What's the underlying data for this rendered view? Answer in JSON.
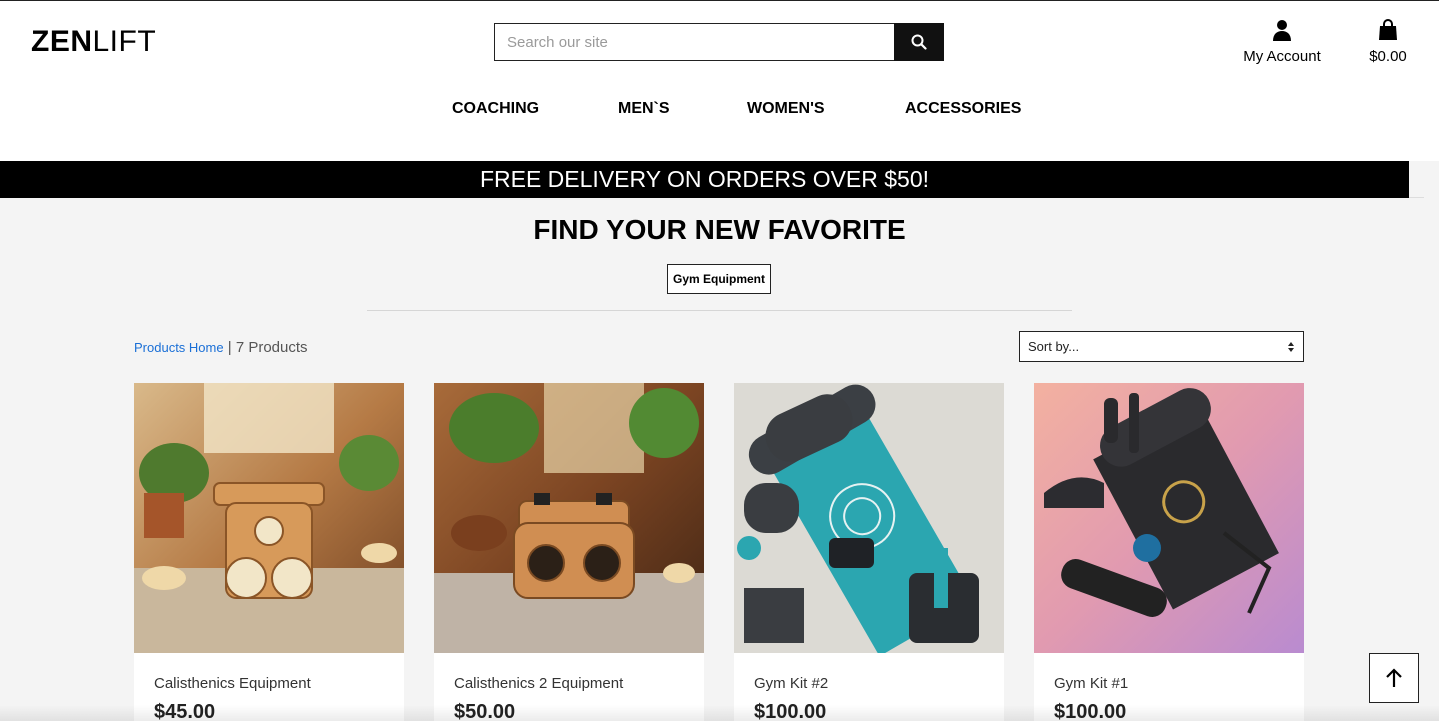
{
  "header": {
    "logo_bold": "ZEN",
    "logo_light": "LIFT",
    "search_placeholder": "Search our site",
    "account_label": "My Account",
    "cart_total": "$0.00"
  },
  "nav": {
    "items": [
      {
        "label": "COACHING"
      },
      {
        "label": "MEN`S"
      },
      {
        "label": "WOMEN'S"
      },
      {
        "label": "ACCESSORIES"
      }
    ]
  },
  "banner": {
    "text": "FREE DELIVERY ON ORDERS OVER $50!"
  },
  "main": {
    "heading": "FIND YOUR NEW FAVORITE",
    "category_tag": "Gym Equipment",
    "breadcrumb_link": "Products Home",
    "breadcrumb_sep": " | ",
    "product_count": "7 Products",
    "sort_label": "Sort by..."
  },
  "products": [
    {
      "title": "Calisthenics Equipment",
      "price": "$45.00"
    },
    {
      "title": "Calisthenics 2 Equipment",
      "price": "$50.00"
    },
    {
      "title": "Gym Kit #2",
      "price": "$100.00"
    },
    {
      "title": "Gym Kit #1",
      "price": "$100.00"
    }
  ],
  "colors": {
    "banner_bg": "#000000",
    "link": "#1a6fd6",
    "page_bg": "#f4f4f4"
  }
}
